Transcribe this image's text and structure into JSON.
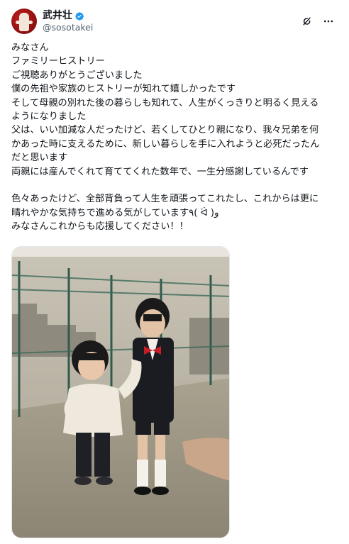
{
  "post": {
    "author": {
      "display_name": "武井壮",
      "handle": "@sosotakei",
      "verified": true,
      "avatar_icon": "avatar-photo"
    },
    "actions": {
      "grok_icon": "grok-icon",
      "more_icon": "more-dots-icon"
    },
    "text_lines": [
      "みなさん",
      "ファミリーヒストリー",
      "ご視聴ありがとうございました",
      "僕の先祖や家族のヒストリーが知れて嬉しかったです",
      "そして母親の別れた後の暮らしも知れて、人生がくっきりと明るく見える",
      "ようになりました",
      "父は、いい加減な人だったけど、若くしてひとり親になり、我々兄弟を何",
      "かあった時に支えるために、新しい暮らしを手に入れようと必死だったん",
      "だと思います",
      "両親には産んでくれて育ててくれた数年で、一生分感謝しているんです",
      "",
      "色々あったけど、全部背負って人生を頑張ってこれたし、これからは更に",
      "晴れやかな気持ちで進める気がしています٩( ᐛ )و",
      "みなさんこれからも応援してください！！"
    ],
    "media": {
      "type": "photo",
      "subject": "two-boys-on-rooftop-photo"
    },
    "colors": {
      "text": "#0f1419",
      "secondary": "#536471",
      "verified_badge": "#1d9bf0",
      "border": "#e1e6ea"
    }
  }
}
